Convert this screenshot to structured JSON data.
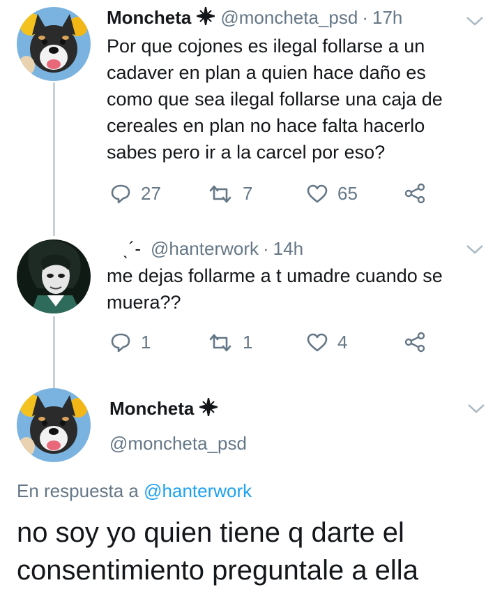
{
  "tweets": [
    {
      "name": "Moncheta",
      "badge_icon": "sparkle-star-icon",
      "handle": "@moncheta_psd",
      "sep": "·",
      "time": "17h",
      "text_lines": [
        "Por que cojones es ilegal follarse a un",
        "cadaver en plan a quien hace daño es",
        "como que sea ilegal follarse una caja de",
        "cereales en plan no hace falta hacerlo",
        "sabes pero ir a la carcel por eso?"
      ],
      "replies": "27",
      "retweets": "7",
      "likes": "65"
    },
    {
      "name": "ˎ´-",
      "handle": "@hanterwork",
      "sep": "·",
      "time": "14h",
      "text_lines": [
        "me dejas follarme a t umadre cuando se",
        "muera??"
      ],
      "replies": "1",
      "retweets": "1",
      "likes": "4"
    }
  ],
  "focus": {
    "name": "Moncheta",
    "badge_icon": "sparkle-star-icon",
    "handle": "@moncheta_psd",
    "reply_prefix": "En respuesta a",
    "reply_to": "@hanterwork",
    "text_lines": [
      "no soy yo quien tiene q darte el",
      "consentimiento preguntale a ella"
    ]
  },
  "colors": {
    "text": "#14171a",
    "secondary": "#657786",
    "link": "#1da1f2",
    "thread_line": "#c9d1d8"
  }
}
